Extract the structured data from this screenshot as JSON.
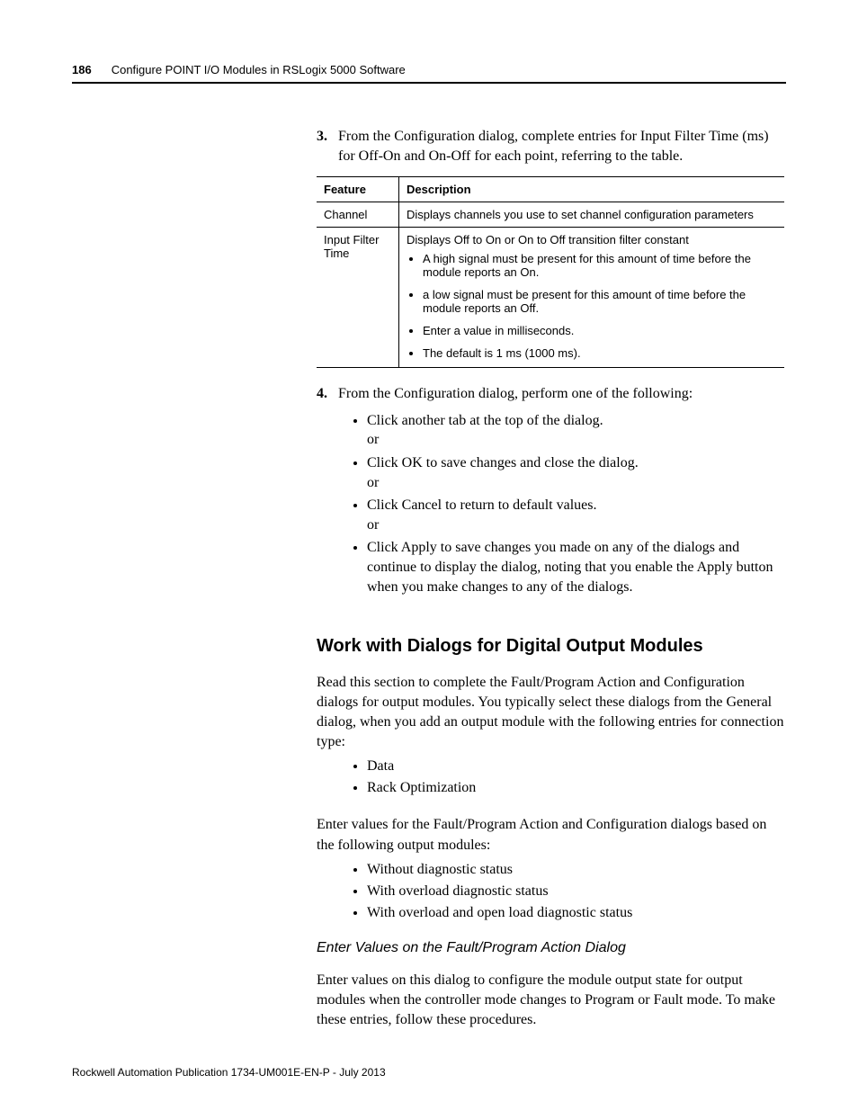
{
  "header": {
    "page_number": "186",
    "chapter_title": "Configure POINT I/O Modules in RSLogix 5000 Software"
  },
  "step3": {
    "num": "3.",
    "text": "From the Configuration dialog, complete entries for Input Filter Time (ms) for Off-On and On-Off for each point, referring to the table."
  },
  "table": {
    "head_feature": "Feature",
    "head_description": "Description",
    "row1_feature": "Channel",
    "row1_desc": "Displays channels you use to set channel configuration parameters",
    "row2_feature": "Input Filter Time",
    "row2_desc_line1": "Displays Off to On or On to Off transition filter constant",
    "row2_b1": "A high signal must be present for this amount of time before the module reports an On.",
    "row2_b2": "a low signal must be present for this amount of time before the module reports an Off.",
    "row2_b3": "Enter a value in milliseconds.",
    "row2_b4": "The default is 1 ms (1000 ms)."
  },
  "step4": {
    "num": "4.",
    "text": "From the Configuration dialog, perform one of the following:",
    "items": [
      "Click another tab at the top of the dialog.",
      "Click OK to save changes and close the dialog.",
      "Click Cancel to return to default values.",
      "Click Apply to save changes you made on any of the dialogs and continue to display the dialog, noting that you enable the Apply button when you make changes to any of the dialogs."
    ],
    "or": "or"
  },
  "section_heading": "Work with Dialogs for Digital Output Modules",
  "section_para": "Read this section to complete the Fault/Program Action and Configuration dialogs for output modules. You typically select these dialogs from the General dialog, when you add an output module with the following entries for connection type:",
  "conn_items": [
    "Data",
    "Rack Optimization"
  ],
  "section_para2": "Enter values for the Fault/Program Action and Configuration dialogs based on the following output modules:",
  "out_items": [
    "Without diagnostic status",
    "With overload diagnostic status",
    "With overload and open load diagnostic status"
  ],
  "subheading": "Enter Values on the Fault/Program Action Dialog",
  "sub_para": "Enter values on this dialog to configure the module output state for output modules when the controller mode changes to Program or Fault mode. To make these entries, follow these procedures.",
  "footer": "Rockwell Automation Publication 1734-UM001E-EN-P - July 2013"
}
